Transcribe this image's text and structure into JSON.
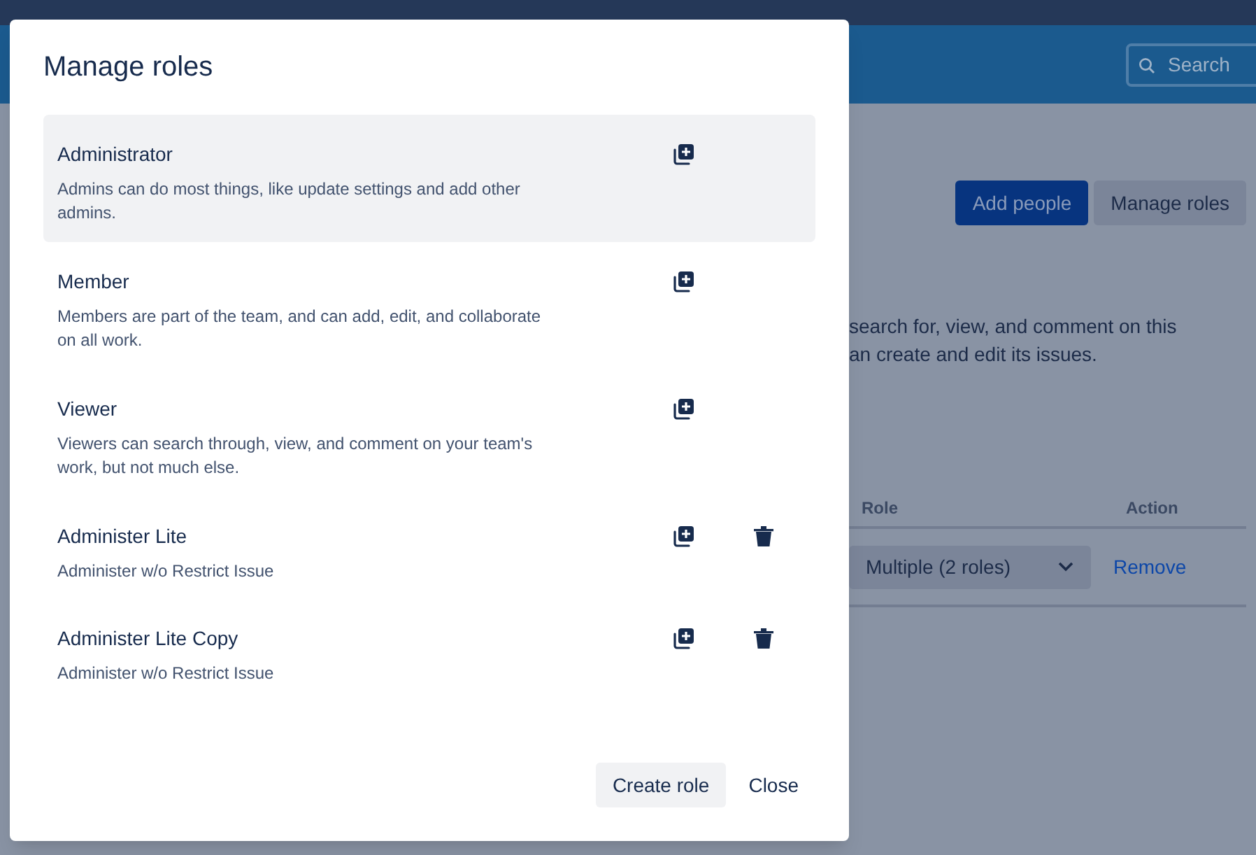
{
  "header": {
    "search": {
      "placeholder": "Search"
    }
  },
  "page": {
    "buttons": [
      {
        "label": "Add people",
        "kind": "primary"
      },
      {
        "label": "Manage roles",
        "kind": "secondary"
      }
    ],
    "description": [
      "search for, view, and comment on this",
      "an create and edit its issues."
    ],
    "table": {
      "columns": [
        "Role",
        "Action"
      ],
      "rows": [
        {
          "role": "Multiple (2 roles)",
          "action": "Remove"
        }
      ]
    }
  },
  "dialog": {
    "title": "Manage roles",
    "roles": [
      {
        "name": "Administrator",
        "description": "Admins can do most things, like update settings and add other admins.",
        "selected": true,
        "deletable": false
      },
      {
        "name": "Member",
        "description": "Members are part of the team, and can add, edit, and collaborate on all work.",
        "selected": false,
        "deletable": false
      },
      {
        "name": "Viewer",
        "description": "Viewers can search through, view, and comment on your team's work, but not much else.",
        "selected": false,
        "deletable": false
      },
      {
        "name": "Administer Lite",
        "description": "Administer w/o Restrict Issue",
        "selected": false,
        "deletable": true
      },
      {
        "name": "Administer Lite Copy",
        "description": "Administer w/o Restrict Issue",
        "selected": false,
        "deletable": true
      }
    ],
    "buttons": [
      {
        "label": "Create role",
        "kind": "secondary"
      },
      {
        "label": "Close",
        "kind": "subtle"
      }
    ]
  }
}
